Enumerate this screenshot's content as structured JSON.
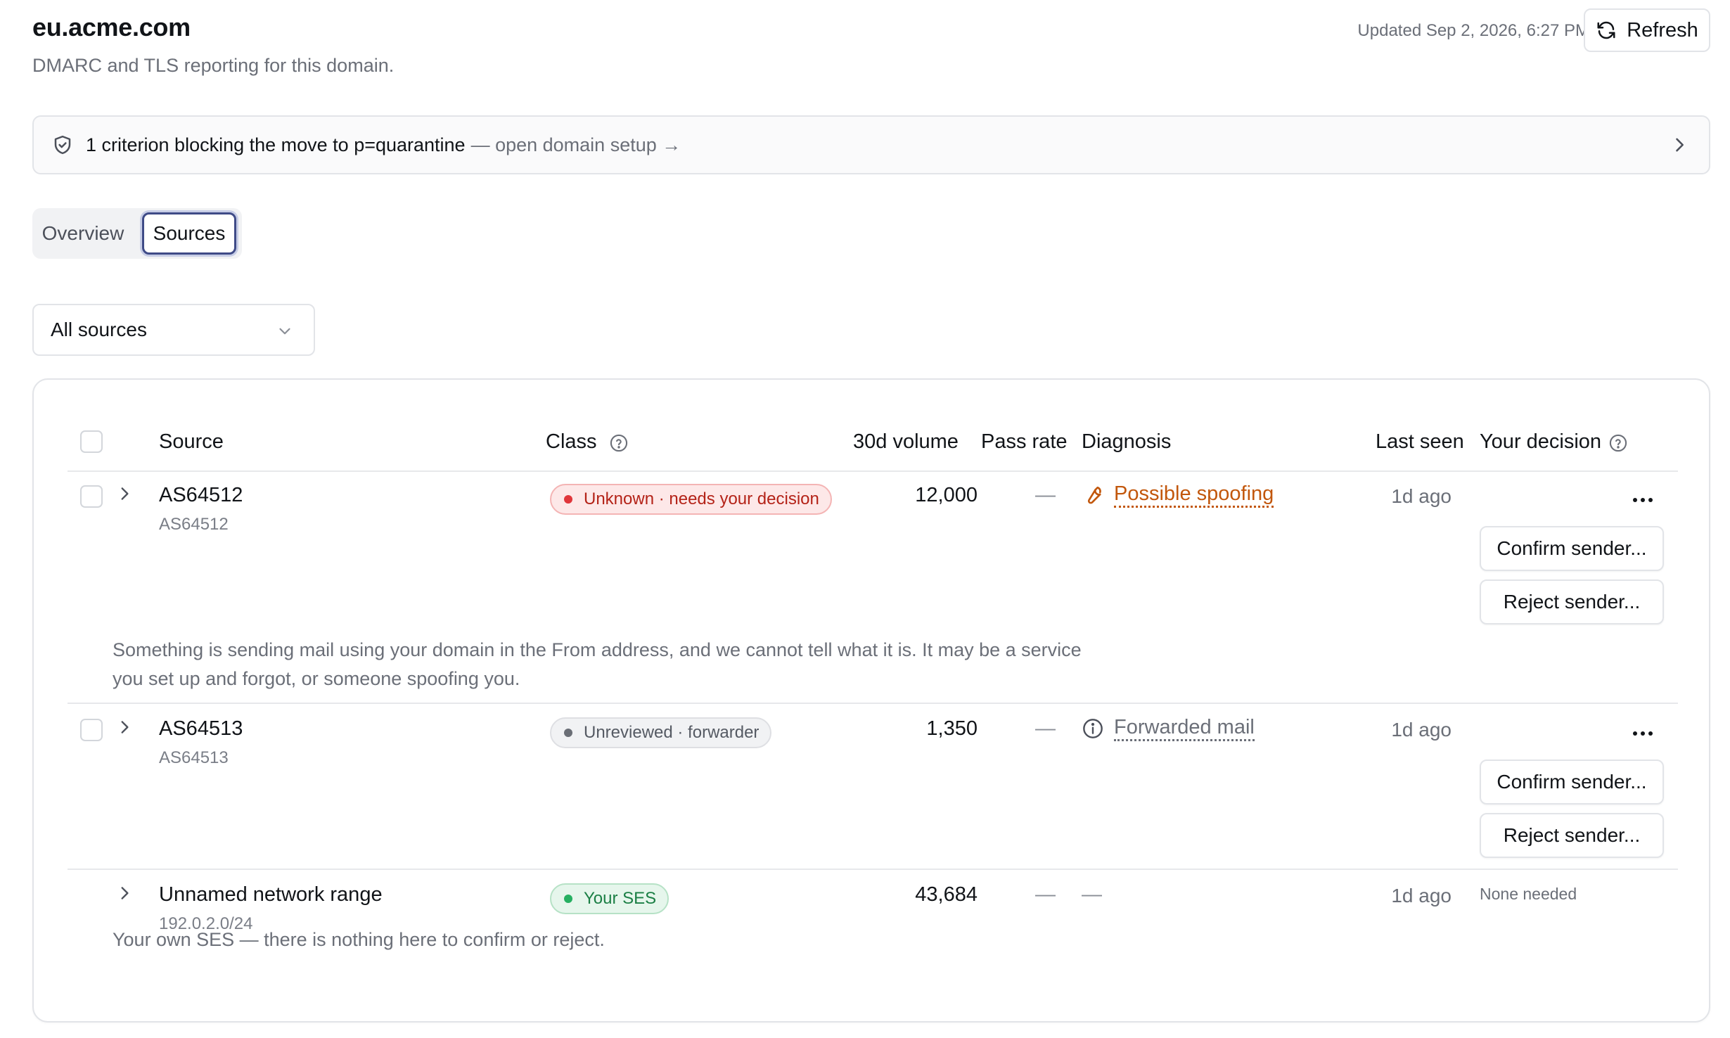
{
  "header": {
    "title": "eu.acme.com",
    "subtitle": "DMARC and TLS reporting for this domain.",
    "updated": "Updated Sep 2, 2026, 6:27 PM",
    "refresh_label": "Refresh"
  },
  "banner": {
    "main": "1 criterion blocking the move to p=quarantine",
    "link": "— open domain setup →"
  },
  "tabs": [
    {
      "label": "Overview",
      "active": false
    },
    {
      "label": "Sources",
      "active": true
    }
  ],
  "filter": {
    "selected": "All sources"
  },
  "table": {
    "columns": {
      "source": "Source",
      "class": "Class",
      "volume": "30d volume",
      "pass_rate": "Pass rate",
      "diagnosis": "Diagnosis",
      "last_seen": "Last seen",
      "decision": "Your decision"
    },
    "rows": [
      {
        "name": "AS64512",
        "sub": "AS64512",
        "class_label": "Unknown · needs your decision",
        "class_status": "danger",
        "volume": "12,000",
        "pass_rate": "—",
        "diagnosis": "Possible spoofing",
        "diagnosis_icon": "wrench-icon",
        "last_seen": "1d ago",
        "confirm_label": "Confirm sender...",
        "reject_label": "Reject sender...",
        "description": "Something is sending mail using your domain in the From address, and we cannot tell what it is. It may be a service you set up and forgot, or someone spoofing you."
      },
      {
        "name": "AS64513",
        "sub": "AS64513",
        "class_label": "Unreviewed · forwarder",
        "class_status": "neutral",
        "volume": "1,350",
        "pass_rate": "—",
        "diagnosis": "Forwarded mail",
        "diagnosis_icon": "info-icon",
        "last_seen": "1d ago",
        "confirm_label": "Confirm sender...",
        "reject_label": "Reject sender..."
      },
      {
        "name": "Unnamed network range",
        "sub": "192.0.2.0/24",
        "class_label": "Your SES",
        "class_status": "success",
        "volume": "43,684",
        "pass_rate": "—",
        "diagnosis": "—",
        "last_seen": "1d ago",
        "decision": "None needed",
        "description": "Your own SES — there is nothing here to confirm or reject."
      }
    ]
  },
  "colors": {
    "accent": "#3f4b87",
    "danger": "#e0363b",
    "warning": "#c2570c",
    "success": "#26b061"
  }
}
